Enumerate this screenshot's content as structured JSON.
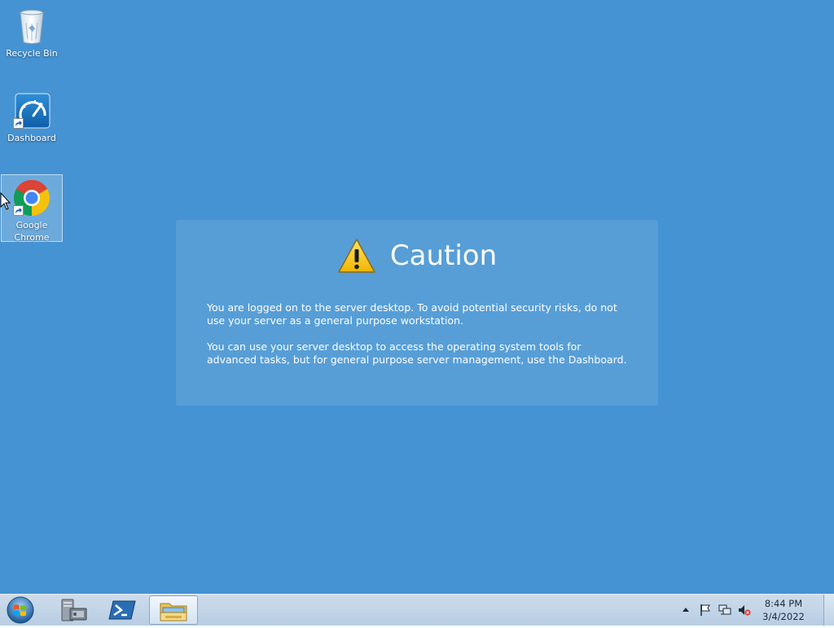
{
  "desktop": {
    "background_color": "#4593d3",
    "icons": [
      {
        "label": "Recycle Bin",
        "icon": "recycle-bin-icon"
      },
      {
        "label": "Dashboard",
        "icon": "dashboard-icon"
      },
      {
        "label": "Google Chrome",
        "icon": "chrome-icon",
        "selected": true
      }
    ]
  },
  "caution": {
    "title": "Caution",
    "icon": "warning-icon",
    "paragraph1": "You are logged on to the server desktop. To avoid potential security risks, do not use your server as a general purpose workstation.",
    "paragraph2": "You can use your server desktop to access the operating system tools for advanced tasks, but for general purpose server management, use the Dashboard."
  },
  "taskbar": {
    "buttons": [
      {
        "icon": "start-orb-icon"
      },
      {
        "icon": "server-manager-icon"
      },
      {
        "icon": "powershell-icon"
      },
      {
        "icon": "file-explorer-icon",
        "active": true
      }
    ],
    "tray": {
      "icons": [
        "show-hidden-icons-icon",
        "action-center-flag-icon",
        "network-icon",
        "volume-muted-icon"
      ],
      "time": "8:44 PM",
      "date": "3/4/2022"
    }
  }
}
